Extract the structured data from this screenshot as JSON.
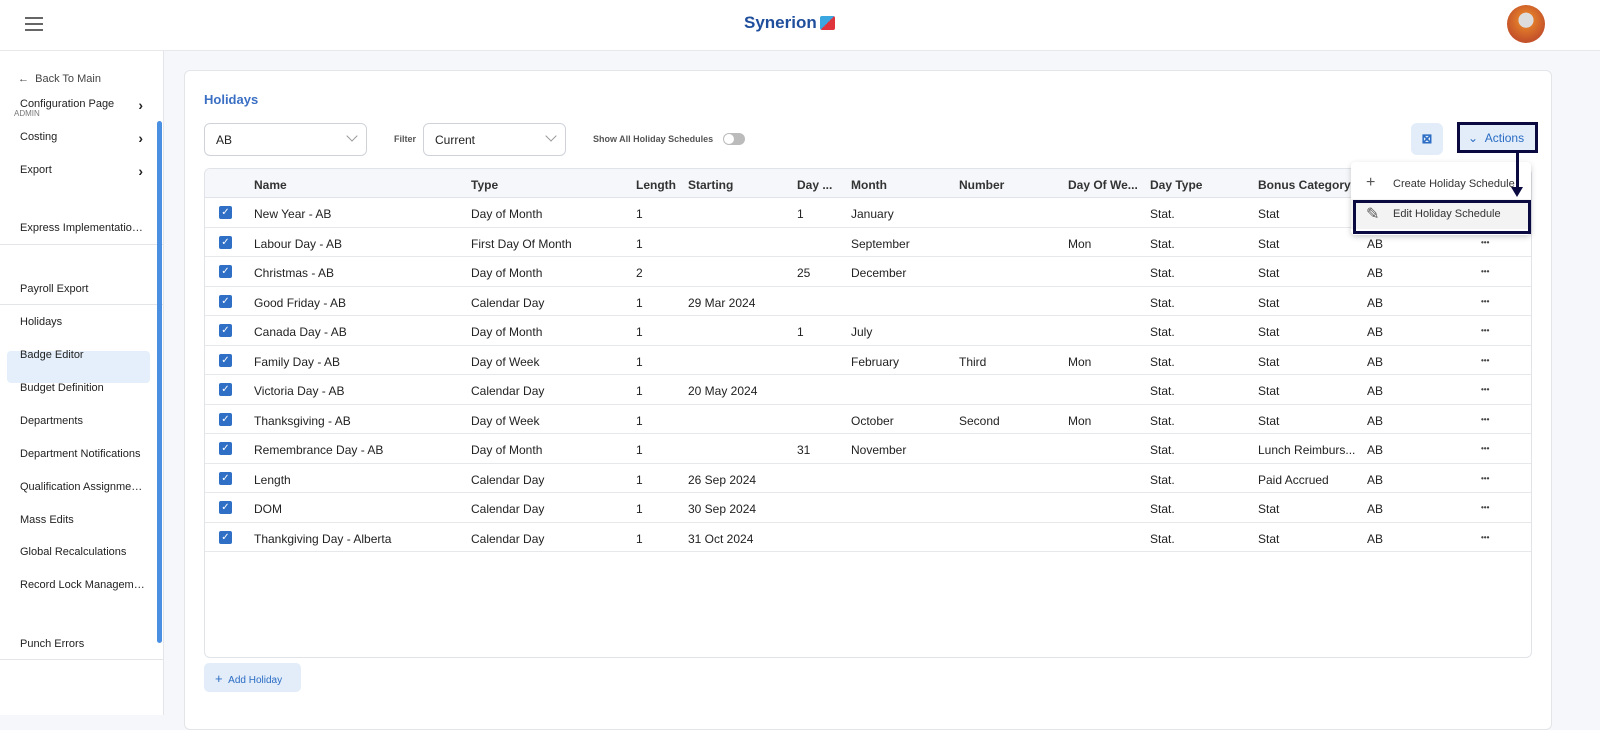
{
  "header": {
    "logo": "Synerion"
  },
  "sidebar": {
    "back": "Back To Main",
    "section": "ADMIN",
    "items": [
      {
        "label": "Configuration Page",
        "chevron": true
      },
      {
        "label": "Costing",
        "chevron": true
      },
      {
        "label": "Export",
        "chevron": true
      },
      {
        "label": "Express Implementation P..."
      },
      {
        "label": "Payroll Export"
      },
      {
        "label": "Holidays",
        "active": true
      },
      {
        "label": "Badge Editor"
      },
      {
        "label": "Budget Definition"
      },
      {
        "label": "Departments"
      },
      {
        "label": "Department Notifications"
      },
      {
        "label": "Qualification Assignments"
      },
      {
        "label": "Mass Edits"
      },
      {
        "label": "Global Recalculations"
      },
      {
        "label": "Record Lock Management"
      },
      {
        "label": "Punch Errors"
      }
    ]
  },
  "page": {
    "title": "Holidays",
    "schedule_select": "AB",
    "filter_label": "Filter",
    "filter_value": "Current",
    "toggle_label": "Show All Holiday Schedules",
    "toggle_on": false,
    "actions_label": "Actions",
    "add_label": "Add Holiday"
  },
  "actions_menu": {
    "items": [
      {
        "icon": "plus-icon",
        "label": "Create Holiday Schedule"
      },
      {
        "icon": "pencil-icon",
        "label": "Edit Holiday Schedule",
        "highlighted": true
      }
    ]
  },
  "table": {
    "columns": [
      "Name",
      "Type",
      "Length",
      "Starting",
      "Day ...",
      "Month",
      "Number",
      "Day Of We...",
      "Day Type",
      "Bonus Category",
      ""
    ],
    "rows": [
      [
        "New Year - AB",
        "Day of Month",
        "1",
        "",
        "1",
        "January",
        "",
        "",
        "Stat.",
        "Stat",
        ""
      ],
      [
        "Labour Day - AB",
        "First Day Of Month",
        "1",
        "",
        "",
        "September",
        "",
        "Mon",
        "Stat.",
        "Stat",
        "AB"
      ],
      [
        "Christmas - AB",
        "Day of Month",
        "2",
        "",
        "25",
        "December",
        "",
        "",
        "Stat.",
        "Stat",
        "AB"
      ],
      [
        "Good Friday - AB",
        "Calendar Day",
        "1",
        "29 Mar 2024",
        "",
        "",
        "",
        "",
        "Stat.",
        "Stat",
        "AB"
      ],
      [
        "Canada Day - AB",
        "Day of Month",
        "1",
        "",
        "1",
        "July",
        "",
        "",
        "Stat.",
        "Stat",
        "AB"
      ],
      [
        "Family Day - AB",
        "Day of Week",
        "1",
        "",
        "",
        "February",
        "Third",
        "Mon",
        "Stat.",
        "Stat",
        "AB"
      ],
      [
        "Victoria Day - AB",
        "Calendar Day",
        "1",
        "20 May 2024",
        "",
        "",
        "",
        "",
        "Stat.",
        "Stat",
        "AB"
      ],
      [
        "Thanksgiving - AB",
        "Day of Week",
        "1",
        "",
        "",
        "October",
        "Second",
        "Mon",
        "Stat.",
        "Stat",
        "AB"
      ],
      [
        "Remembrance Day - AB",
        "Day of Month",
        "1",
        "",
        "31",
        "November",
        "",
        "",
        "Stat.",
        "Lunch Reimburs...",
        "AB"
      ],
      [
        "Length",
        "Calendar Day",
        "1",
        "26 Sep 2024",
        "",
        "",
        "",
        "",
        "Stat.",
        "Paid Accrued",
        "AB"
      ],
      [
        "DOM",
        "Calendar Day",
        "1",
        "30 Sep 2024",
        "",
        "",
        "",
        "",
        "Stat.",
        "Stat",
        "AB"
      ],
      [
        "Thankgiving Day - Alberta",
        "Calendar Day",
        "1",
        "31 Oct 2024",
        "",
        "",
        "",
        "",
        "Stat.",
        "Stat",
        "AB"
      ]
    ]
  }
}
